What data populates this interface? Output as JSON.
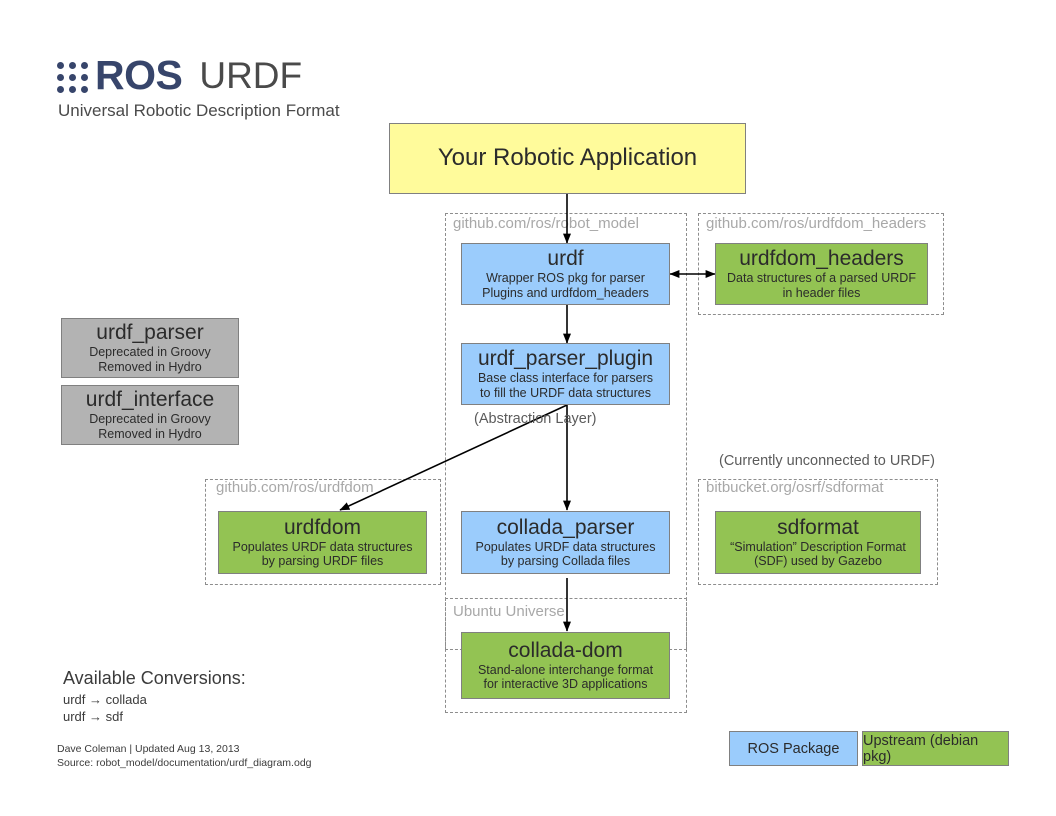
{
  "header": {
    "logo_text": "ROS",
    "logo_icon": "ros-dot-grid-icon",
    "title": "URDF",
    "subtitle": "Universal Robotic Description Format"
  },
  "nodes": {
    "app": {
      "title": "Your Robotic Application",
      "desc": "",
      "color": "#fffb9b"
    },
    "urdf": {
      "title": "urdf",
      "desc_line1": "Wrapper ROS pkg for parser",
      "desc_line2": "Plugins and urdfdom_headers",
      "color": "#9bccfc"
    },
    "urdfdom_headers": {
      "title": "urdfdom_headers",
      "desc_line1": "Data structures of a parsed URDF",
      "desc_line2": "in header files",
      "color": "#93c353"
    },
    "urdf_parser": {
      "title": "urdf_parser",
      "desc_line1": "Deprecated in Groovy",
      "desc_line2": "Removed in Hydro",
      "color": "#b3b3b3"
    },
    "urdf_interface": {
      "title": "urdf_interface",
      "desc_line1": "Deprecated in Groovy",
      "desc_line2": "Removed in Hydro",
      "color": "#b3b3b3"
    },
    "urdf_parser_plugin": {
      "title": "urdf_parser_plugin",
      "desc_line1": "Base class interface for parsers",
      "desc_line2": "to fill the URDF data structures",
      "color": "#9bccfc"
    },
    "urdfdom": {
      "title": "urdfdom",
      "desc_line1": "Populates URDF data structures",
      "desc_line2": "by parsing URDF files",
      "color": "#93c353"
    },
    "collada_parser": {
      "title": "collada_parser",
      "desc_line1": "Populates URDF data structures",
      "desc_line2": "by parsing Collada files",
      "color": "#9bccfc"
    },
    "sdformat": {
      "title": "sdformat",
      "desc_line1": "“Simulation” Description Format",
      "desc_line2": "(SDF) used by Gazebo",
      "color": "#93c353"
    },
    "collada_dom": {
      "title": "collada-dom",
      "desc_line1": "Stand-alone interchange format",
      "desc_line2": "for interactive 3D applications",
      "color": "#93c353"
    }
  },
  "groups": {
    "robot_model": "github.com/ros/robot_model",
    "urdfdom_headers_repo": "github.com/ros/urdfdom_headers",
    "urdfdom_repo": "github.com/ros/urdfdom",
    "sdformat_repo": "bitbucket.org/osrf/sdformat",
    "ubuntu_universe": "Ubuntu Universe"
  },
  "notes": {
    "abstraction_layer": "(Abstraction Layer)",
    "unconnected": "(Currently unconnected to URDF)"
  },
  "conversions": {
    "title": "Available Conversions:",
    "rows": [
      "urdf → collada",
      "urdf → sdf"
    ]
  },
  "credit": {
    "line1": "Dave Coleman | Updated Aug 13, 2013",
    "line2": "Source: robot_model/documentation/urdf_diagram.odg"
  },
  "legend": {
    "ros_package": "ROS Package",
    "upstream": "Upstream (debian pkg)"
  }
}
